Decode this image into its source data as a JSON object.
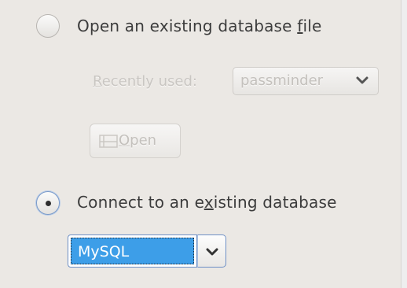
{
  "options": {
    "open_file": {
      "label_before": "Open an existing database ",
      "label_mnemonic": "f",
      "label_after": "ile",
      "selected": false
    },
    "recent": {
      "label_mnemonic": "R",
      "label_rest": "ecently used:",
      "value": "passminder",
      "arrow_icon": "chevron-down-icon"
    },
    "open_button": {
      "label_mnemonic": "O",
      "label_rest": "pen",
      "icon": "open-folder-icon"
    },
    "connect": {
      "label_before": "Connect to an e",
      "label_mnemonic": "x",
      "label_after": "isting database",
      "selected": true
    },
    "database_type": {
      "value": "MySQL",
      "arrow_icon": "chevron-down-icon"
    }
  },
  "colors": {
    "selection": "#3d9ee8",
    "focus_border": "#6e90c6",
    "disabled_text": "#c9c6c2"
  }
}
